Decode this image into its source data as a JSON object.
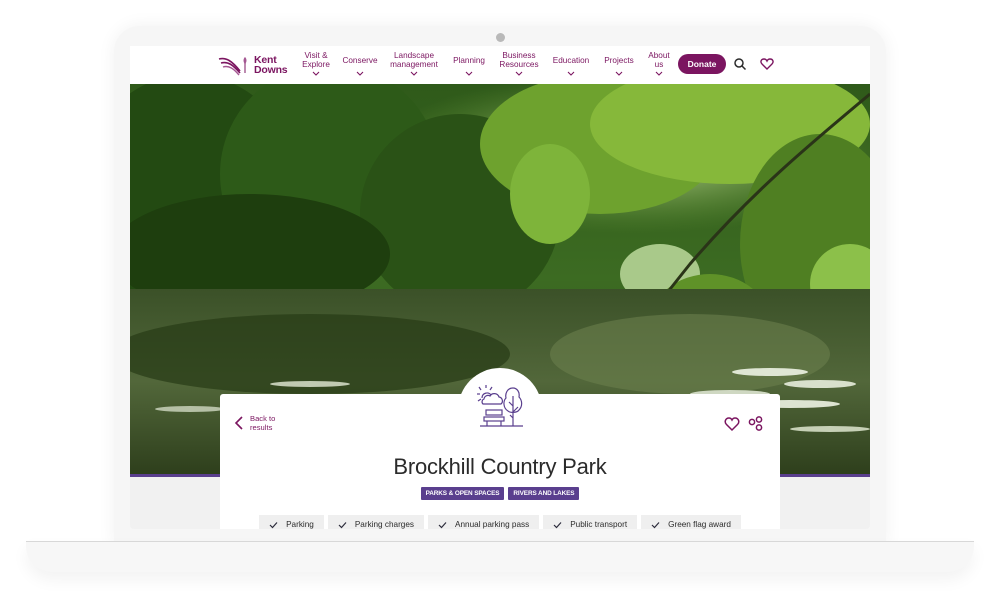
{
  "site": {
    "logo_line1": "Kent",
    "logo_line2": "Downs",
    "brand_color": "#7b1560",
    "accent_color": "#5a3f8e"
  },
  "nav": {
    "items": [
      {
        "line1": "Visit &",
        "line2": "Explore"
      },
      {
        "line1": "Conserve",
        "line2": ""
      },
      {
        "line1": "Landscape",
        "line2": "management"
      },
      {
        "line1": "Planning",
        "line2": ""
      },
      {
        "line1": "Business",
        "line2": "Resources"
      },
      {
        "line1": "Education",
        "line2": ""
      },
      {
        "line1": "Projects",
        "line2": ""
      },
      {
        "line1": "About",
        "line2": "us"
      }
    ],
    "donate_label": "Donate",
    "icons": [
      "search-icon",
      "heart-icon"
    ]
  },
  "hero": {
    "image": "river-woodland-photo"
  },
  "card": {
    "back_label": "Back to results",
    "category_icon": "park-bench-tree-icon",
    "title": "Brockhill Country Park",
    "tags": [
      "PARKS & OPEN SPACES",
      "RIVERS AND LAKES"
    ],
    "features": [
      "Parking",
      "Parking charges",
      "Annual parking pass",
      "Public transport",
      "Green flag award"
    ],
    "actions": [
      "favourite-heart-icon",
      "share-icon"
    ]
  }
}
